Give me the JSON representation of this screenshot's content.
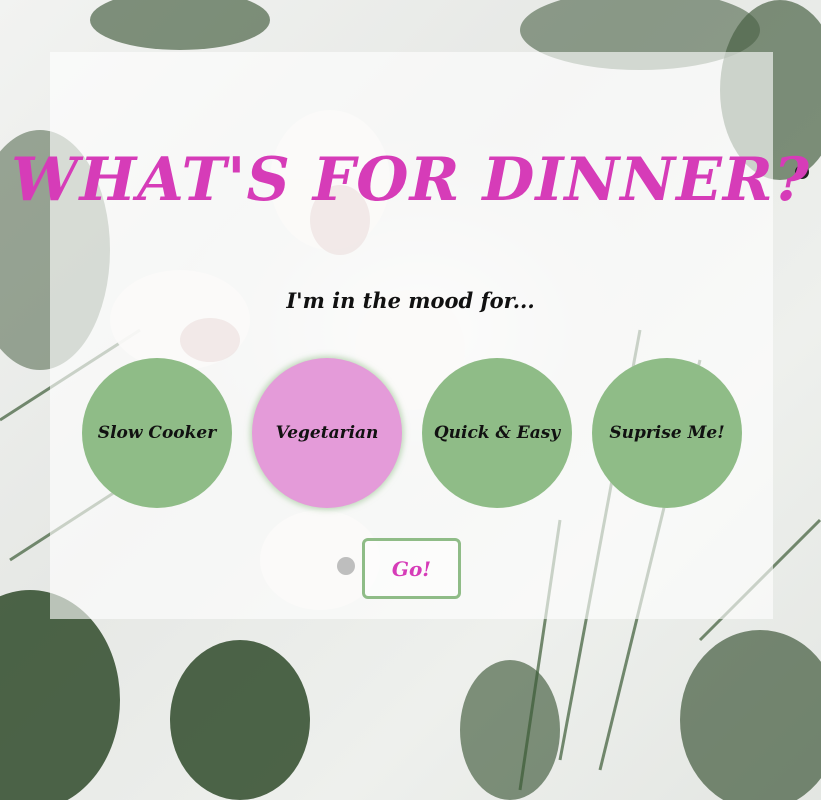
{
  "header": {
    "title": "WHAT'S FOR DINNER?",
    "subtitle": "I'm in the mood for..."
  },
  "options": [
    {
      "label": "Slow Cooker",
      "selected": false
    },
    {
      "label": "Vegetarian",
      "selected": true
    },
    {
      "label": "Quick & Easy",
      "selected": false
    },
    {
      "label": "Suprise Me!",
      "selected": false
    }
  ],
  "go_button": {
    "label": "Go!"
  },
  "colors": {
    "title": "#d63cb8",
    "option": "#8fbc87",
    "option_selected": "#e49bd9",
    "go_border": "#8fbc87"
  }
}
